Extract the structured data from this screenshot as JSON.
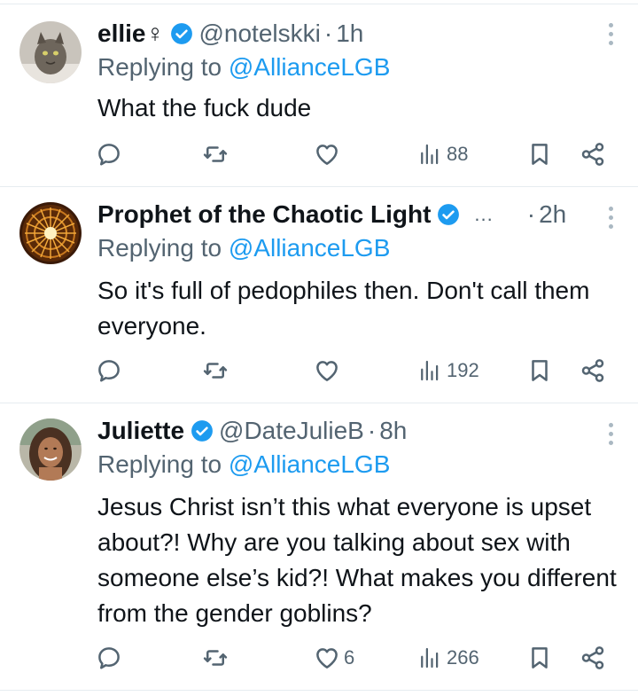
{
  "tweets": [
    {
      "name": "ellie♀",
      "handle": "@notelskki",
      "time": "1h",
      "replying_prefix": "Replying to ",
      "replying_to": "@AllianceLGB",
      "text": "What the fuck dude",
      "likes": "",
      "views": "88",
      "verified": true,
      "truncated": false
    },
    {
      "name": "Prophet of the Chaotic Light",
      "handle": "",
      "time": "2h",
      "replying_prefix": "Replying to ",
      "replying_to": "@AllianceLGB",
      "text": "So it's full of pedophiles then. Don't call them everyone.",
      "likes": "",
      "views": "192",
      "verified": true,
      "truncated": true,
      "ellipsis": "..."
    },
    {
      "name": "Juliette",
      "handle": "@DateJulieB",
      "time": "8h",
      "replying_prefix": "Replying to ",
      "replying_to": "@AllianceLGB",
      "text": "Jesus Christ isn’t this what everyone is upset about?! Why are you talking about sex with someone else’s kid?! What makes you different from the gender goblins?",
      "likes": "6",
      "views": "266",
      "verified": true,
      "truncated": false
    }
  ],
  "separator": "·",
  "colors": {
    "accent": "#1d9bf0",
    "text": "#0f1419",
    "muted": "#536471",
    "divider": "#e6ecf0"
  },
  "icons": [
    "reply-icon",
    "retweet-icon",
    "like-icon",
    "views-icon",
    "bookmark-icon",
    "share-icon",
    "more-icon",
    "verified-badge-icon"
  ]
}
